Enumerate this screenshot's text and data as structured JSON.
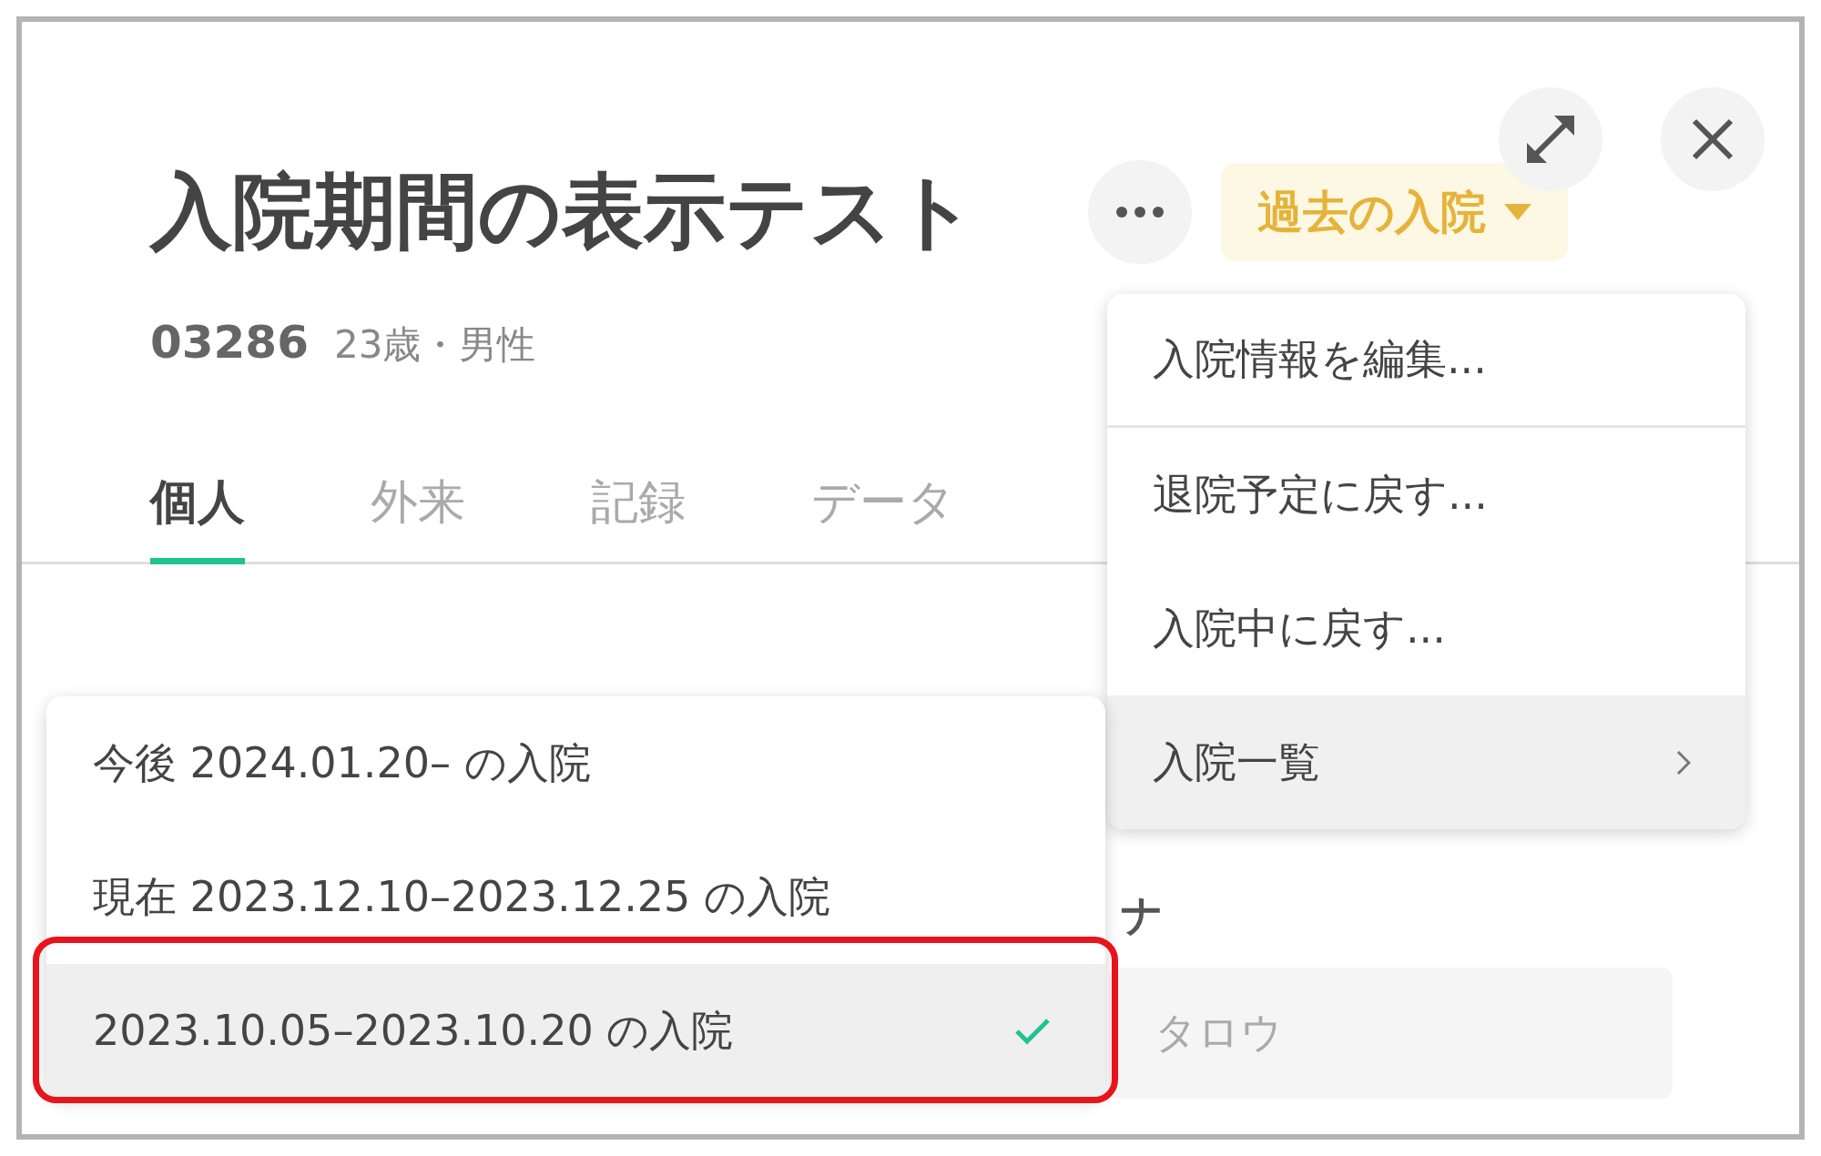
{
  "header": {
    "title": "入院期間の表示テスト",
    "admission_button": {
      "label": "過去の入院"
    }
  },
  "patient": {
    "id": "03286",
    "details": "23歳・男性"
  },
  "tabs": [
    {
      "label": "個人",
      "selected": true
    },
    {
      "label": "外来",
      "selected": false
    },
    {
      "label": "記録",
      "selected": false
    },
    {
      "label": "データ",
      "selected": false
    }
  ],
  "form": {
    "label": "ナ",
    "value": "タロウ"
  },
  "menu": {
    "items": [
      {
        "label": "入院情報を編集...",
        "kind": "action",
        "divider_after": true,
        "highlighted": false
      },
      {
        "label": "退院予定に戻す...",
        "kind": "action",
        "divider_after": false,
        "highlighted": false
      },
      {
        "label": "入院中に戻す...",
        "kind": "action",
        "divider_after": false,
        "highlighted": false
      },
      {
        "label": "入院一覧",
        "kind": "submenu",
        "divider_after": false,
        "highlighted": true
      }
    ]
  },
  "submenu": {
    "items": [
      {
        "label": "今後 2024.01.20– の入院",
        "selected": false,
        "outlined": false
      },
      {
        "label": "現在 2023.12.10–2023.12.25 の入院",
        "selected": false,
        "outlined": false
      },
      {
        "label": "2023.10.05–2023.10.20 の入院",
        "selected": true,
        "outlined": true
      }
    ]
  }
}
